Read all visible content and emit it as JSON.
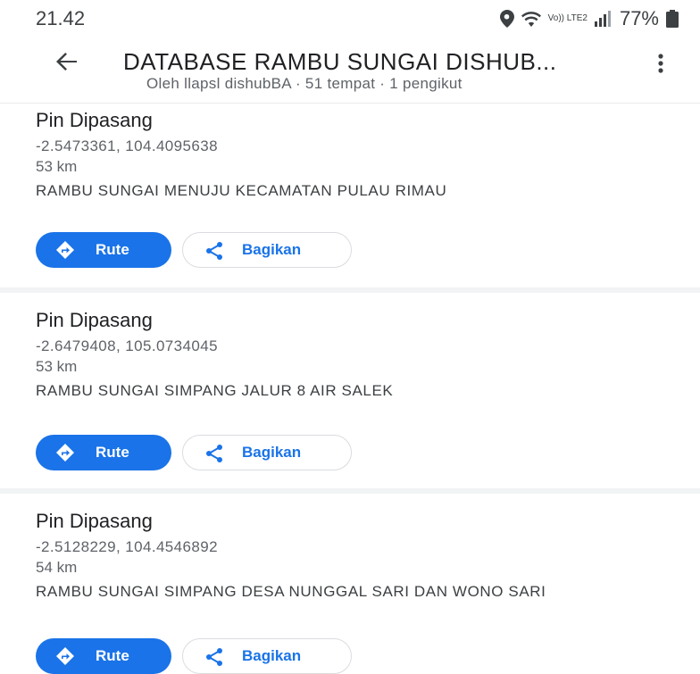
{
  "status_bar": {
    "time": "21.42",
    "network_label": "Vo)) LTE2",
    "battery_percent": "77%",
    "icons": [
      "location-icon",
      "wifi-icon",
      "signal-icon",
      "battery-icon"
    ]
  },
  "header": {
    "title": "DATABASE RAMBU SUNGAI DISHUB...",
    "subtitle": "Oleh llapsl dishubBA · 51 tempat · 1 pengikut",
    "icons": [
      "back-arrow-icon",
      "more-vert-icon"
    ]
  },
  "places": [
    {
      "title": "Pin Dipasang",
      "coords": "-2.5473361, 104.4095638",
      "distance": "53 km",
      "description": "RAMBU SUNGAI MENUJU KECAMATAN PULAU RIMAU",
      "route_label": "Rute",
      "share_label": "Bagikan"
    },
    {
      "title": "Pin Dipasang",
      "coords": "-2.6479408, 105.0734045",
      "distance": "53 km",
      "description": "RAMBU SUNGAI SIMPANG JALUR 8 AIR SALEK",
      "route_label": "Rute",
      "share_label": "Bagikan"
    },
    {
      "title": "Pin Dipasang",
      "coords": "-2.5128229, 104.4546892",
      "distance": "54 km",
      "description": "RAMBU SUNGAI SIMPANG DESA NUNGGAL SARI DAN WONO SARI",
      "route_label": "Rute",
      "share_label": "Bagikan"
    }
  ],
  "colors": {
    "accent": "#1a73e8",
    "divider": "#f1f3f4",
    "secondary_text": "#5f6368"
  }
}
